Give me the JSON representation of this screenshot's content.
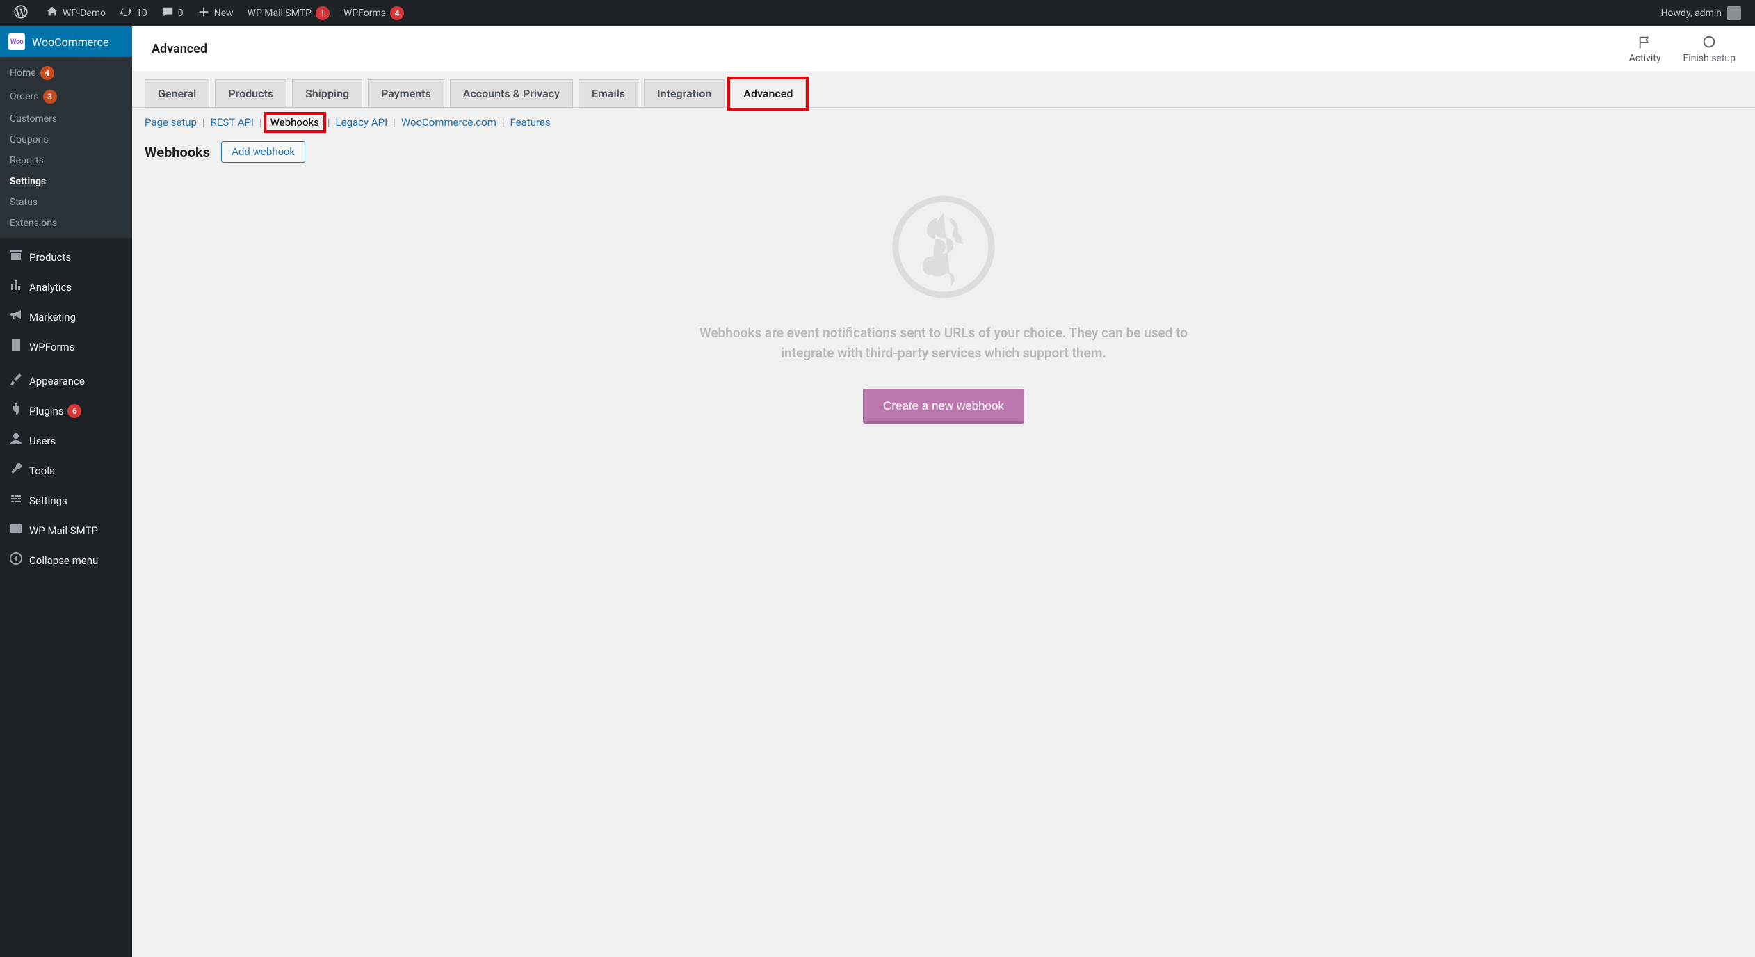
{
  "adminbar": {
    "site_name": "WP-Demo",
    "updates_count": "10",
    "comments_count": "0",
    "new_label": "New",
    "wpmail_label": "WP Mail SMTP",
    "wpmail_badge": "!",
    "wpforms_label": "WPForms",
    "wpforms_count": "4",
    "howdy": "Howdy, admin"
  },
  "sidebar": {
    "top_label": "WooCommerce",
    "submenu": [
      {
        "label": "Home",
        "badge": "4"
      },
      {
        "label": "Orders",
        "badge": "3"
      },
      {
        "label": "Customers",
        "badge": null
      },
      {
        "label": "Coupons",
        "badge": null
      },
      {
        "label": "Reports",
        "badge": null
      },
      {
        "label": "Settings",
        "badge": null,
        "active": true
      },
      {
        "label": "Status",
        "badge": null
      },
      {
        "label": "Extensions",
        "badge": null
      }
    ],
    "main": [
      {
        "icon": "archive",
        "label": "Products"
      },
      {
        "icon": "bars",
        "label": "Analytics"
      },
      {
        "icon": "megaphone",
        "label": "Marketing"
      },
      {
        "icon": "form",
        "label": "WPForms"
      },
      {
        "sep": true
      },
      {
        "icon": "brush",
        "label": "Appearance"
      },
      {
        "icon": "plug",
        "label": "Plugins",
        "badge": "6"
      },
      {
        "icon": "user",
        "label": "Users"
      },
      {
        "icon": "wrench",
        "label": "Tools"
      },
      {
        "icon": "sliders",
        "label": "Settings"
      },
      {
        "icon": "mail",
        "label": "WP Mail SMTP"
      },
      {
        "icon": "collapse",
        "label": "Collapse menu"
      }
    ]
  },
  "header": {
    "title": "Advanced",
    "activity": "Activity",
    "finish": "Finish setup"
  },
  "tabs": [
    {
      "label": "General"
    },
    {
      "label": "Products"
    },
    {
      "label": "Shipping"
    },
    {
      "label": "Payments"
    },
    {
      "label": "Accounts & Privacy"
    },
    {
      "label": "Emails"
    },
    {
      "label": "Integration"
    },
    {
      "label": "Advanced",
      "active": true,
      "highlight": true
    }
  ],
  "subtabs": [
    {
      "label": "Page setup"
    },
    {
      "label": "REST API"
    },
    {
      "label": "Webhooks",
      "current": true,
      "highlight": true
    },
    {
      "label": "Legacy API"
    },
    {
      "label": "WooCommerce.com"
    },
    {
      "label": "Features"
    }
  ],
  "page": {
    "heading": "Webhooks",
    "add_button": "Add webhook",
    "empty_text": "Webhooks are event notifications sent to URLs of your choice. They can be used to integrate with third-party services which support them.",
    "create_button": "Create a new webhook"
  }
}
